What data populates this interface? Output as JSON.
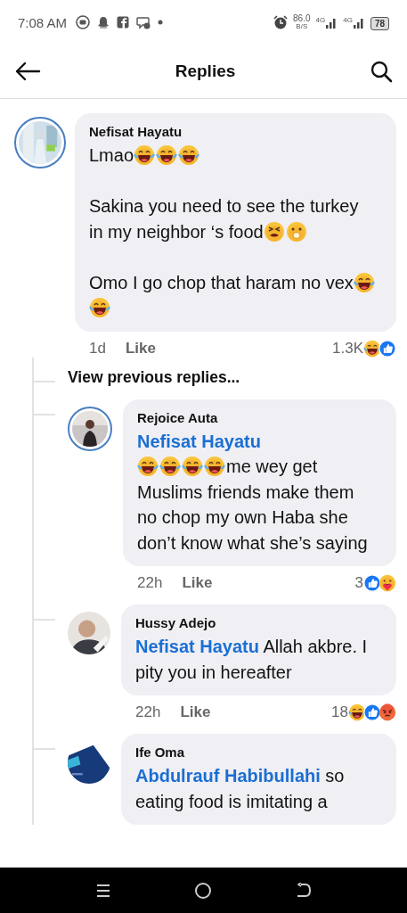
{
  "status_bar": {
    "time": "7:08 AM",
    "network_speed": "86.0",
    "speed_unit": "B/S",
    "signals": [
      {
        "label": "4G"
      },
      {
        "label": "4G"
      }
    ],
    "battery": "78"
  },
  "header": {
    "title": "Replies"
  },
  "comment": {
    "avatar": {
      "ring": true,
      "kind": "picture"
    },
    "author": "Nefisat Hayatu",
    "paragraphs": [
      [
        {
          "kind": "text",
          "text": "Lmao"
        },
        {
          "kind": "laugh"
        },
        {
          "kind": "laugh"
        },
        {
          "kind": "laugh"
        }
      ],
      [
        {
          "kind": "text",
          "text": "Sakina you need to see the turkey in my neighbor ‘s food"
        },
        {
          "kind": "squint"
        },
        {
          "kind": "gasp"
        }
      ],
      [
        {
          "kind": "text",
          "text": "Omo I go chop that haram no vex"
        },
        {
          "kind": "laugh"
        },
        {
          "kind": "laugh"
        }
      ]
    ],
    "time": "1d",
    "like": "Like",
    "reaction_count": "1.3K",
    "reactions": [
      {
        "kind": "haha"
      },
      {
        "kind": "like"
      }
    ]
  },
  "view_previous": "View previous replies...",
  "replies": [
    {
      "avatar": {
        "ring": true,
        "kind": "picture"
      },
      "author": "Rejoice Auta",
      "paragraphs": [
        [
          {
            "kind": "mention",
            "text": "Nefisat Hayatu",
            "own_line": true
          },
          {
            "kind": "laugh"
          },
          {
            "kind": "laugh"
          },
          {
            "kind": "laugh"
          },
          {
            "kind": "laugh"
          },
          {
            "kind": "text",
            "text": "me wey get Muslims friends make them no chop my own Haba she don’t know what she’s saying"
          }
        ]
      ],
      "time": "22h",
      "like": "Like",
      "reaction_count": "3",
      "reactions": [
        {
          "kind": "like"
        },
        {
          "kind": "care"
        }
      ]
    },
    {
      "avatar": {
        "ring": false,
        "kind": "picture"
      },
      "author": "Hussy Adejo",
      "paragraphs": [
        [
          {
            "kind": "mention",
            "text": "Nefisat Hayatu",
            "own_line": false
          },
          {
            "kind": "text",
            "text": "Allah akbre. I pity you in hereafter"
          }
        ]
      ],
      "time": "22h",
      "like": "Like",
      "reaction_count": "18",
      "reactions": [
        {
          "kind": "haha"
        },
        {
          "kind": "like"
        },
        {
          "kind": "angry"
        }
      ]
    },
    {
      "avatar": {
        "ring": false,
        "kind": "picture"
      },
      "author": "Ife Oma",
      "paragraphs": [
        [
          {
            "kind": "mention",
            "text": "Abdulrauf Habibullahi",
            "own_line": false
          },
          {
            "kind": "text",
            "text": "so eating food is imitating a"
          }
        ]
      ]
    }
  ]
}
